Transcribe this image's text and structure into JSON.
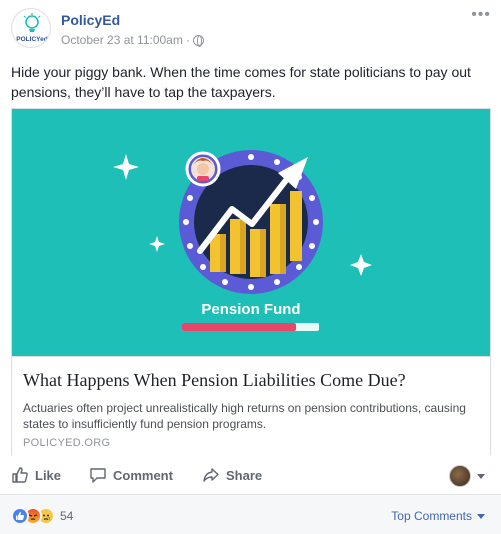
{
  "post": {
    "author": "PolicyEd",
    "timestamp": "October 23 at 11:00am",
    "separator": "·",
    "logo_text": "POLICYed",
    "text": "Hide your piggy bank. When the time comes for state politicians to pay out pensions, they’ll have to tap the taxpayers.",
    "more_icon": "•••"
  },
  "link": {
    "image_caption": "Pension Fund",
    "title": "What Happens When Pension Liabilities Come Due?",
    "description": "Actuaries often project unrealistically high returns on pension contributions, causing states to insufficiently fund pension programs.",
    "domain": "POLICYED.ORG"
  },
  "actions": {
    "like": "Like",
    "comment": "Comment",
    "share": "Share"
  },
  "footer": {
    "reaction_count": "54",
    "sort_label": "Top Comments"
  },
  "colors": {
    "accent": "#365899",
    "image_bg": "#1ebfb6",
    "badge_ring": "#5b5bd6",
    "bars": "#f2c230",
    "progress": "#e8456b"
  },
  "icons": [
    "globe-icon",
    "more-options-icon",
    "like-icon",
    "comment-icon",
    "share-icon",
    "caret-down-icon"
  ]
}
